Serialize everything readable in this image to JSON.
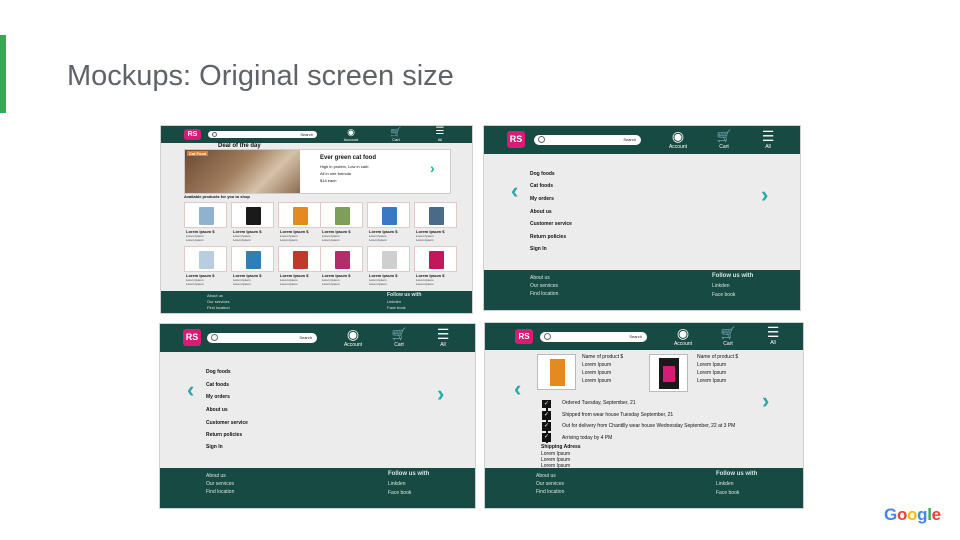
{
  "slide": {
    "title": "Mockups: Original screen size",
    "google": [
      "G",
      "o",
      "o",
      "g",
      "l",
      "e"
    ],
    "google_colors": [
      "#4285f4",
      "#ea4335",
      "#fbbc05",
      "#4285f4",
      "#34a853",
      "#ea4335"
    ],
    "accent_color": "#34a853"
  },
  "header": {
    "logo": "RS",
    "search_label": "Search",
    "account_label": "Account",
    "cart_label": "Cart",
    "all_label": "All",
    "account_icon": "account-icon",
    "cart_icon": "cart-icon",
    "menu_icon": "hamburger-menu-icon",
    "color": "#174a42",
    "logo_color": "#d81b73"
  },
  "footer": {
    "about": "About us",
    "services": "Our services",
    "location": "Find location",
    "follow": "Follow us with",
    "linkedin": "Linkden",
    "facebook": "Face book"
  },
  "menu": {
    "items": [
      "Dog foods",
      "Cat foods",
      "My orders",
      "About us",
      "Customer service",
      "Return  policies",
      "Sign In"
    ]
  },
  "home": {
    "deal_title": "Deal of the day",
    "deal_image_label": "Cat Food",
    "deal_name": "Ever green cat food",
    "deal_line1": "High in protein, Low in carb",
    "deal_line2": "All in one formula",
    "deal_price": "$14 each",
    "available_title": "Available  products for you to shop",
    "product_name": "Lorem Ipsum $",
    "product_sub": "Lorem Ipsum",
    "row1_colors": [
      "#8fb3cf",
      "#1a1a1a",
      "#e38b1f",
      "#7ca05a",
      "#3b78c4",
      "#4a6a8a"
    ],
    "row2_colors": [
      "#b9cde0",
      "#2f7fb5",
      "#c0392b",
      "#b22d6a",
      "#cfcfcf",
      "#c2185b"
    ]
  },
  "orders": {
    "product_name": "Name of product $",
    "product_line": "Lorem Ipsum",
    "status1": "Ordered Tuesday, September, 21",
    "status2": "Shipped from wear house Tuesday  September, 21",
    "status3": "Out for delivery from Chantilly wear house  Wednesday September, 22 at 3 PM",
    "status4": "Arriving today by 4 PM",
    "shipping_title": "Shipping Adress",
    "shipping_line": "Lorem Ipsum"
  }
}
